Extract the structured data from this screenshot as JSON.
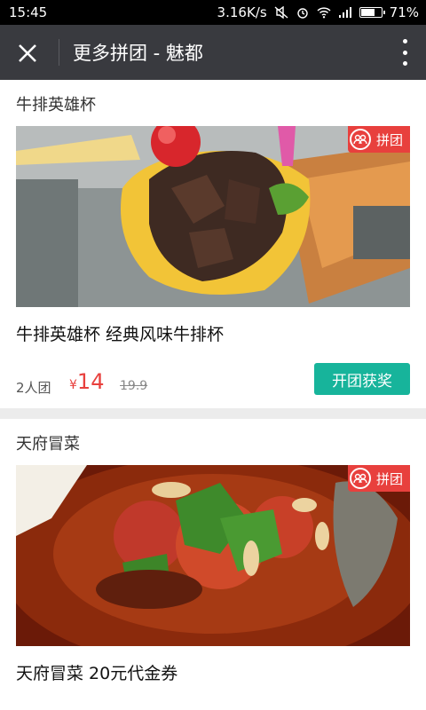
{
  "status_bar": {
    "time": "15:45",
    "network_speed": "3.16K/s",
    "battery_percent": "71%",
    "battery_level": 0.71
  },
  "app_bar": {
    "title": "更多拼团 - 魅都",
    "close_icon": "close-icon",
    "more_icon": "more-vertical-icon"
  },
  "deals": [
    {
      "category": "牛排英雄杯",
      "badge": "拼团",
      "name": "牛排英雄杯 经典风味牛排杯",
      "group_size": "2人团",
      "currency": "¥",
      "price": "14",
      "original_price": "19.9",
      "button": "开团获奖"
    },
    {
      "category": "天府冒菜",
      "badge": "拼团",
      "name": "天府冒菜 20元代金券",
      "group_size": "",
      "currency": "",
      "price": "",
      "original_price": "",
      "button": ""
    }
  ],
  "colors": {
    "app_bar": "#393a3f",
    "accent_red": "#e8403d",
    "button_teal": "#17b49b"
  }
}
